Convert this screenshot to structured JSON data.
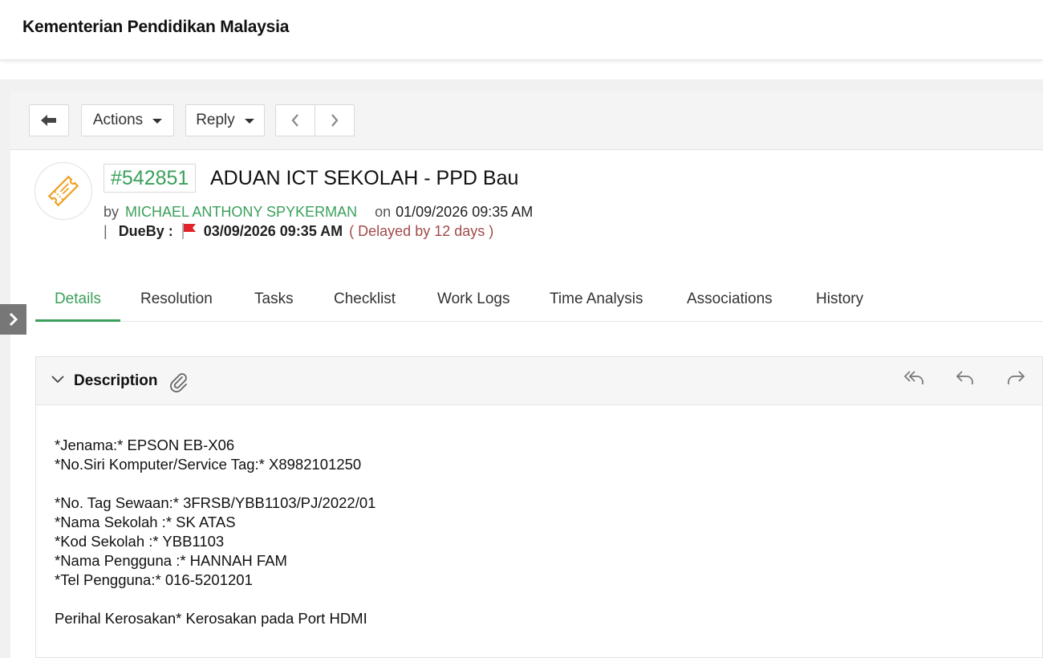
{
  "header": {
    "org_name": "Kementerian Pendidikan Malaysia"
  },
  "toolbar": {
    "back_icon": "back-arrow-icon",
    "actions_label": "Actions",
    "reply_label": "Reply",
    "prev_icon": "chevron-left-icon",
    "next_icon": "chevron-right-icon"
  },
  "ticket": {
    "id": "#542851",
    "subject": "ADUAN ICT SEKOLAH - PPD Bau",
    "by_label": "by",
    "author": "MICHAEL ANTHONY SPYKERMAN",
    "on_label": "on",
    "created": "01/09/2026 09:35 AM",
    "separator": "|",
    "dueby_label": "DueBy :",
    "due_date": "03/09/2026 09:35 AM",
    "delay_text": "( Delayed by 12 days )",
    "accent_color": "#3aa05b",
    "delay_color": "#a24a4a",
    "flag_color": "#e0242a"
  },
  "tabs": [
    {
      "label": "Details",
      "active": true
    },
    {
      "label": "Resolution"
    },
    {
      "label": "Tasks"
    },
    {
      "label": "Checklist"
    },
    {
      "label": "Work Logs"
    },
    {
      "label": "Time Analysis"
    },
    {
      "label": "Associations"
    },
    {
      "label": "History"
    }
  ],
  "description": {
    "title": "Description",
    "lines": [
      "*Jenama:* EPSON EB-X06",
      "*No.Siri Komputer/Service Tag:* X8982101250",
      "",
      "*No. Tag Sewaan:* 3FRSB/YBB1103/PJ/2022/01",
      "*Nama Sekolah :* SK ATAS",
      "*Kod Sekolah :* YBB1103",
      "*Nama Pengguna :* HANNAH FAM",
      "*Tel Pengguna:* 016-5201201",
      "",
      "Perihal Kerosakan* Kerosakan pada Port HDMI"
    ]
  }
}
